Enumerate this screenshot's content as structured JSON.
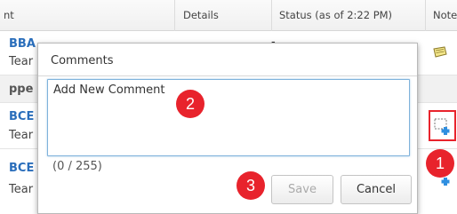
{
  "grid": {
    "columns": [
      {
        "label": "nt"
      },
      {
        "label": "Details"
      },
      {
        "label": "Status (as of 2:22 PM)"
      },
      {
        "label": "Note"
      }
    ],
    "rows": [
      {
        "id": "BBA",
        "sub": "Tear"
      },
      {
        "group": "ppe"
      },
      {
        "id": "BCE",
        "sub": "Tear"
      },
      {
        "id": "BCE",
        "sub": "Tear"
      }
    ]
  },
  "dialog": {
    "title": "Comments",
    "placeholder": "Add New Comment",
    "counter": "(0 / 255)",
    "save_label": "Save",
    "cancel_label": "Cancel"
  },
  "callouts": {
    "one": "1",
    "two": "2",
    "three": "3"
  },
  "colors": {
    "callout": "#e8232c",
    "link": "#2a6ebb",
    "focus_border": "#7fb2db"
  },
  "icons": [
    "note-icon",
    "add-comment-icon"
  ]
}
